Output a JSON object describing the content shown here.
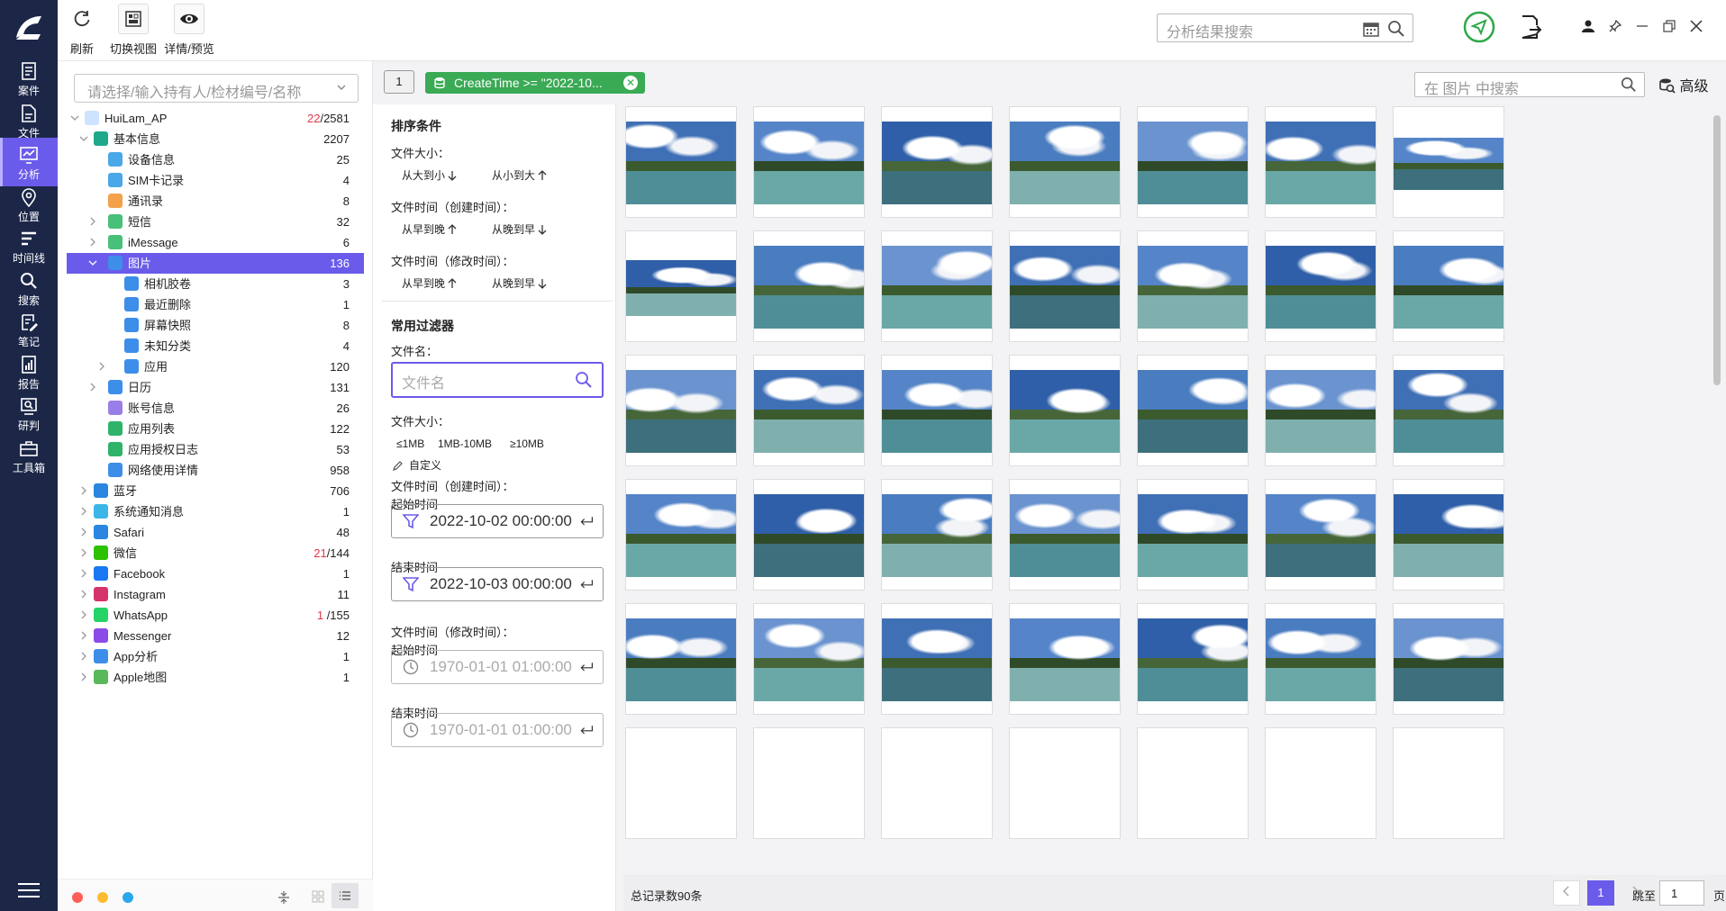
{
  "nav": {
    "items": [
      {
        "label": "案件",
        "icon": "case-icon"
      },
      {
        "label": "文件",
        "icon": "file-icon"
      },
      {
        "label": "分析",
        "icon": "analysis-icon",
        "active": true
      },
      {
        "label": "位置",
        "icon": "location-icon"
      },
      {
        "label": "时间线",
        "icon": "timeline-icon"
      },
      {
        "label": "搜索",
        "icon": "search-icon"
      },
      {
        "label": "笔记",
        "icon": "note-icon"
      },
      {
        "label": "报告",
        "icon": "report-icon"
      },
      {
        "label": "研判",
        "icon": "judge-icon"
      },
      {
        "label": "工具箱",
        "icon": "toolbox-icon"
      }
    ]
  },
  "toolbar": {
    "refresh_label": "刷新",
    "switch_view_label": "切换视图",
    "detail_label": "详情/预览",
    "search_placeholder": "分析结果搜索"
  },
  "tree": {
    "owner_placeholder": "请选择/输入持有人/检材编号/名称",
    "rows": [
      {
        "label": "HuiLam_AP",
        "red": "22",
        "count": "/2581",
        "level": 0,
        "expanded": true,
        "icon": "apple-icon"
      },
      {
        "label": "基本信息",
        "count": "2207",
        "level": 1,
        "expanded": true,
        "icon": "info-icon"
      },
      {
        "label": "设备信息",
        "count": "25",
        "level": 2,
        "icon": "device-icon"
      },
      {
        "label": "SIM卡记录",
        "count": "4",
        "level": 2,
        "icon": "sim-icon"
      },
      {
        "label": "通讯录",
        "count": "8",
        "level": 2,
        "icon": "contacts-icon"
      },
      {
        "label": "短信",
        "count": "32",
        "level": 2,
        "collapsed": true,
        "icon": "sms-icon"
      },
      {
        "label": "iMessage",
        "count": "6",
        "level": 2,
        "collapsed": true,
        "icon": "imessage-icon"
      },
      {
        "label": "图片",
        "count": "136",
        "level": 2,
        "expanded": true,
        "selected": true,
        "icon": "picture-icon"
      },
      {
        "label": "相机胶卷",
        "count": "3",
        "level": 3,
        "icon": "picture-icon"
      },
      {
        "label": "最近删除",
        "count": "1",
        "level": 3,
        "icon": "picture-icon"
      },
      {
        "label": "屏幕快照",
        "count": "8",
        "level": 3,
        "icon": "picture-icon"
      },
      {
        "label": "未知分类",
        "count": "4",
        "level": 3,
        "icon": "picture-icon"
      },
      {
        "label": "应用",
        "count": "120",
        "level": 3,
        "collapsed": true,
        "icon": "picture-icon"
      },
      {
        "label": "日历",
        "count": "131",
        "level": 2,
        "collapsed": true,
        "icon": "calendar-icon"
      },
      {
        "label": "账号信息",
        "count": "26",
        "level": 2,
        "icon": "account-icon"
      },
      {
        "label": "应用列表",
        "count": "122",
        "level": 2,
        "icon": "applist-icon"
      },
      {
        "label": "应用授权日志",
        "count": "53",
        "level": 2,
        "icon": "applog-icon"
      },
      {
        "label": "网络使用详情",
        "count": "958",
        "level": 2,
        "icon": "network-icon"
      },
      {
        "label": "蓝牙",
        "count": "706",
        "level": 1,
        "collapsed": true,
        "icon": "bluetooth-icon"
      },
      {
        "label": "系统通知消息",
        "count": "1",
        "level": 1,
        "collapsed": true,
        "icon": "notification-icon"
      },
      {
        "label": "Safari",
        "count": "48",
        "level": 1,
        "collapsed": true,
        "icon": "safari-icon"
      },
      {
        "label": "微信",
        "red": "21",
        "count": "/144",
        "level": 1,
        "collapsed": true,
        "icon": "wechat-icon"
      },
      {
        "label": "Facebook",
        "count": "1",
        "level": 1,
        "collapsed": true,
        "icon": "facebook-icon"
      },
      {
        "label": "Instagram",
        "count": "11",
        "level": 1,
        "collapsed": true,
        "icon": "instagram-icon"
      },
      {
        "label": "WhatsApp",
        "red": "1",
        "count": " /155",
        "level": 1,
        "collapsed": true,
        "icon": "whatsapp-icon"
      },
      {
        "label": "Messenger",
        "count": "12",
        "level": 1,
        "collapsed": true,
        "icon": "messenger-icon"
      },
      {
        "label": "App分析",
        "count": "1",
        "level": 1,
        "collapsed": true,
        "icon": "app-analysis-icon"
      },
      {
        "label": "Apple地图",
        "count": "1",
        "level": 1,
        "collapsed": true,
        "icon": "apple-maps-icon"
      }
    ]
  },
  "filterbar": {
    "tag_number": "1",
    "chip_label": "CreateTime >= \"2022-10...",
    "pic_search_placeholder": "在 图片 中搜索",
    "advanced_label": "高级"
  },
  "filter": {
    "sort_title": "排序条件",
    "size_label": "文件大小：",
    "size_desc": "从大到小",
    "size_asc": "从小到大",
    "ctime_label": "文件时间（创建时间）：",
    "ctime_asc": "从早到晚",
    "ctime_desc": "从晚到早",
    "mtime_label": "文件时间（修改时间）：",
    "mtime_asc": "从早到晚",
    "mtime_desc": "从晚到早",
    "common_title": "常用过滤器",
    "name_label": "文件名：",
    "name_placeholder": "文件名",
    "size2_label": "文件大小：",
    "size_opt1": "≤1MB",
    "size_opt2": "1MB-10MB",
    "size_opt3": "≥10MB",
    "custom_label": "自定义",
    "ctime2_label": "文件时间（创建时间）：",
    "start_label": "起始时间",
    "ctime_start": "2022-10-02 00:00:00",
    "end_label": "结束时间",
    "ctime_end": "2022-10-03 00:00:00",
    "mtime2_label": "文件时间（修改时间）：",
    "start2_label": "起始时间",
    "mtime_start": "1970-01-01 01:00:00",
    "end2_label": "结束时间",
    "mtime_end": "1970-01-01 01:00:00"
  },
  "footer": {
    "total": "总记录数90条",
    "page": "1",
    "jump_label": "跳至",
    "jump_value": "1",
    "page_unit": "页"
  },
  "colors": {
    "accent": "#6b5bea",
    "nav_bg": "#1c2748",
    "chip": "#3aaa55",
    "red_count": "#e0384a"
  }
}
